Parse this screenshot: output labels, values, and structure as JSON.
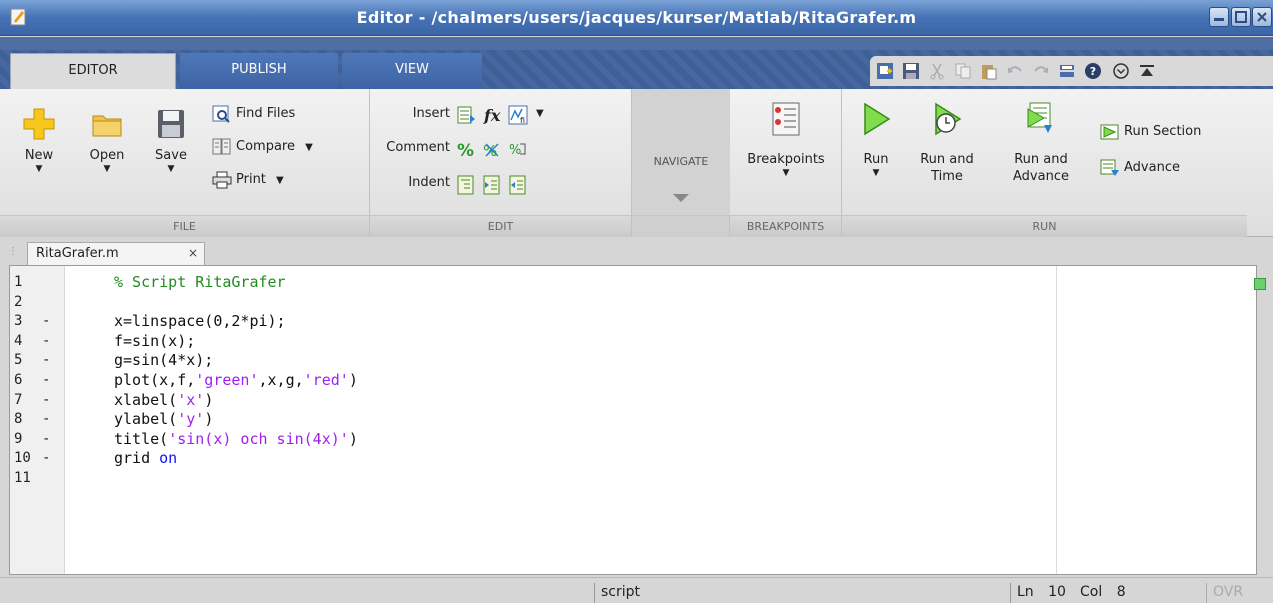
{
  "window": {
    "title": "Editor - /chalmers/users/jacques/kurser/Matlab/RitaGrafer.m"
  },
  "tabs": [
    {
      "label": "EDITOR",
      "active": true
    },
    {
      "label": "PUBLISH",
      "active": false
    },
    {
      "label": "VIEW",
      "active": false
    }
  ],
  "file": {
    "new_label": "New",
    "open_label": "Open",
    "save_label": "Save",
    "find_files_label": "Find Files",
    "compare_label": "Compare",
    "print_label": "Print",
    "section_label": "FILE"
  },
  "edit": {
    "insert_label": "Insert",
    "comment_label": "Comment",
    "indent_label": "Indent",
    "section_label": "EDIT"
  },
  "navigate": {
    "label": "NAVIGATE"
  },
  "breakpoints": {
    "button_label": "Breakpoints",
    "section_label": "BREAKPOINTS"
  },
  "run": {
    "run_label": "Run",
    "run_time_label_1": "Run and",
    "run_time_label_2": "Time",
    "run_advance_label_1": "Run and",
    "run_advance_label_2": "Advance",
    "run_section_label": "Run Section",
    "advance_label": "Advance",
    "section_label": "RUN"
  },
  "document": {
    "tab_label": "RitaGrafer.m",
    "close_glyph": "×"
  },
  "code_lines": [
    {
      "num": "1",
      "dash": "",
      "segments": [
        {
          "text": "% Script RitaGrafer",
          "cls": "cmt"
        }
      ]
    },
    {
      "num": "2",
      "dash": "",
      "segments": []
    },
    {
      "num": "3",
      "dash": "-",
      "segments": [
        {
          "text": "x=linspace(0,2*pi);",
          "cls": ""
        }
      ]
    },
    {
      "num": "4",
      "dash": "-",
      "segments": [
        {
          "text": "f=sin(x);",
          "cls": ""
        }
      ]
    },
    {
      "num": "5",
      "dash": "-",
      "segments": [
        {
          "text": "g=sin(4*x);",
          "cls": ""
        }
      ]
    },
    {
      "num": "6",
      "dash": "-",
      "segments": [
        {
          "text": "plot(x,f,",
          "cls": ""
        },
        {
          "text": "'green'",
          "cls": "str"
        },
        {
          "text": ",x,g,",
          "cls": ""
        },
        {
          "text": "'red'",
          "cls": "str"
        },
        {
          "text": ")",
          "cls": ""
        }
      ]
    },
    {
      "num": "7",
      "dash": "-",
      "segments": [
        {
          "text": "xlabel(",
          "cls": ""
        },
        {
          "text": "'x'",
          "cls": "str"
        },
        {
          "text": ")",
          "cls": ""
        }
      ]
    },
    {
      "num": "8",
      "dash": "-",
      "segments": [
        {
          "text": "ylabel(",
          "cls": ""
        },
        {
          "text": "'y'",
          "cls": "str"
        },
        {
          "text": ")",
          "cls": ""
        }
      ]
    },
    {
      "num": "9",
      "dash": "-",
      "segments": [
        {
          "text": "title(",
          "cls": ""
        },
        {
          "text": "'sin(x) och sin(4x)'",
          "cls": "str"
        },
        {
          "text": ")",
          "cls": ""
        }
      ]
    },
    {
      "num": "10",
      "dash": "-",
      "segments": [
        {
          "text": "grid ",
          "cls": ""
        },
        {
          "text": "on",
          "cls": "kw"
        }
      ]
    },
    {
      "num": "11",
      "dash": "",
      "segments": []
    }
  ],
  "status": {
    "mode": "script",
    "ln_label": "Ln",
    "ln_value": "10",
    "col_label": "Col",
    "col_value": "8",
    "ovr": "OVR"
  },
  "colors": {
    "comment": "#228b22",
    "string": "#a020f0",
    "keyword": "#1010ff",
    "titlebar": "#4673b5"
  }
}
